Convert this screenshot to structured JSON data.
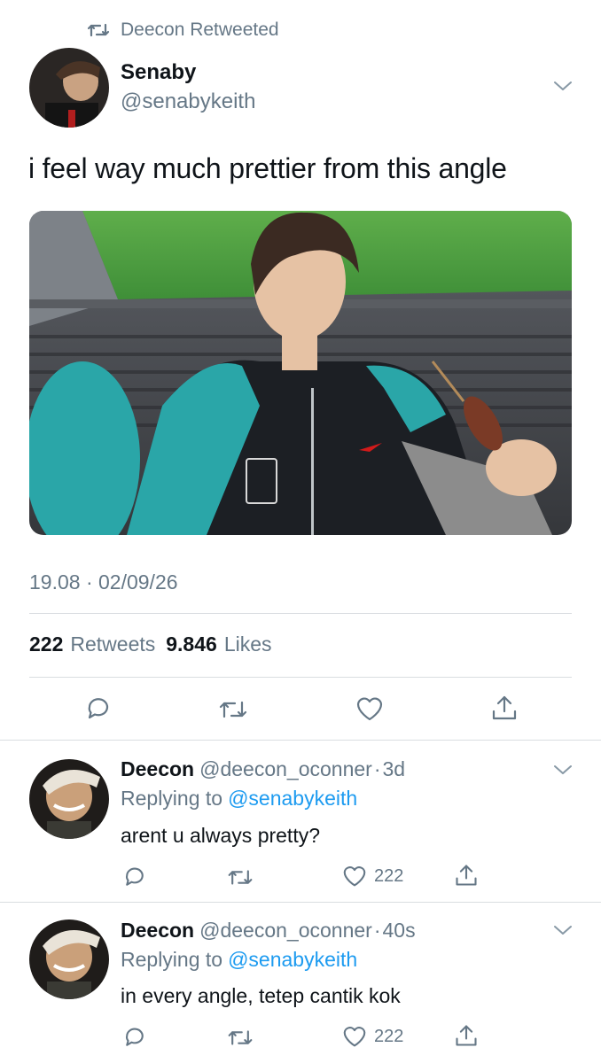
{
  "retweet_banner": {
    "icon": "retweet-icon",
    "text": "Deecon Retweeted"
  },
  "main_tweet": {
    "author_name": "Senaby",
    "author_handle": "@senabykeith",
    "text": "i feel way much prettier from this angle",
    "timestamp": "19.08 · 02/09/26",
    "retweets_count": "222",
    "retweets_label": "Retweets",
    "likes_count": "9.846",
    "likes_label": "Likes",
    "actions": [
      "reply-icon",
      "retweet-icon",
      "heart-icon",
      "share-icon"
    ]
  },
  "replies": [
    {
      "author_name": "Deecon",
      "author_handle": "@deecon_oconner",
      "time": "3d",
      "replying_prefix": "Replying to",
      "replying_to": "@senabykeith",
      "text": "arent u always pretty?",
      "like_count": "222"
    },
    {
      "author_name": "Deecon",
      "author_handle": "@deecon_oconner",
      "time": "40s",
      "replying_prefix": "Replying to",
      "replying_to": "@senabykeith",
      "text": "in every angle, tetep cantik kok",
      "like_count": "222"
    }
  ],
  "colors": {
    "link_blue": "#1d9bf0",
    "muted_grey": "#657786",
    "text": "#0f1419"
  }
}
